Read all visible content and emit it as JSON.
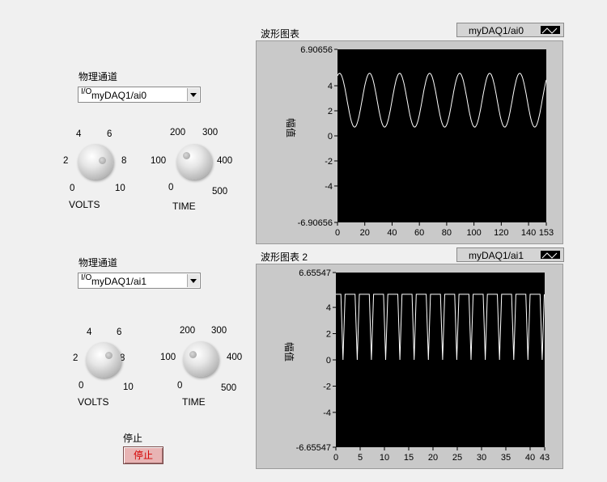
{
  "panel1": {
    "channel_label": "物理通道",
    "io_icon": "I/O",
    "channel_value": "myDAQ1/ai0",
    "volts": {
      "label": "VOLTS",
      "ticks": [
        "0",
        "2",
        "4",
        "6",
        "8",
        "10"
      ]
    },
    "time": {
      "label": "TIME",
      "ticks": [
        "0",
        "100",
        "200",
        "300",
        "400",
        "500"
      ]
    }
  },
  "panel2": {
    "channel_label": "物理通道",
    "io_icon": "I/O",
    "channel_value": "myDAQ1/ai1",
    "volts": {
      "label": "VOLTS",
      "ticks": [
        "0",
        "2",
        "4",
        "6",
        "8",
        "10"
      ]
    },
    "time": {
      "label": "TIME",
      "ticks": [
        "0",
        "100",
        "200",
        "300",
        "400",
        "500"
      ]
    }
  },
  "stop": {
    "label": "停止",
    "button": "停止"
  },
  "graph1": {
    "title": "波形图表",
    "legend": "myDAQ1/ai0",
    "ylabel": "幅值"
  },
  "graph2": {
    "title": "波形图表 2",
    "legend": "myDAQ1/ai1",
    "ylabel": "幅值"
  },
  "chart_data": [
    {
      "type": "line",
      "title": "波形图表",
      "ylabel": "幅值",
      "xlabel": "",
      "ylim": [
        -6.90656,
        6.90656
      ],
      "xlim": [
        0,
        153
      ],
      "y_ticks": [
        "6.90656",
        "4",
        "2",
        "0",
        "-2",
        "-4",
        "-6.90656"
      ],
      "x_ticks": [
        "0",
        "20",
        "40",
        "60",
        "80",
        "100",
        "120",
        "140",
        "153"
      ],
      "series": [
        {
          "name": "myDAQ1/ai0",
          "waveform": "sine",
          "min": 0.7,
          "max": 5.0,
          "period": 22,
          "start": 4.8
        }
      ]
    },
    {
      "type": "line",
      "title": "波形图表 2",
      "ylabel": "幅值",
      "xlabel": "",
      "ylim": [
        -6.65547,
        6.65547
      ],
      "xlim": [
        0,
        43
      ],
      "y_ticks": [
        "6.65547",
        "4",
        "2",
        "0",
        "-2",
        "-4",
        "-6.65547"
      ],
      "x_ticks": [
        "0",
        "5",
        "10",
        "15",
        "20",
        "25",
        "30",
        "35",
        "40",
        "43"
      ],
      "series": [
        {
          "name": "myDAQ1/ai1",
          "waveform": "trapezoid",
          "min": 0.0,
          "max": 5.0,
          "period": 2.93
        }
      ]
    }
  ]
}
